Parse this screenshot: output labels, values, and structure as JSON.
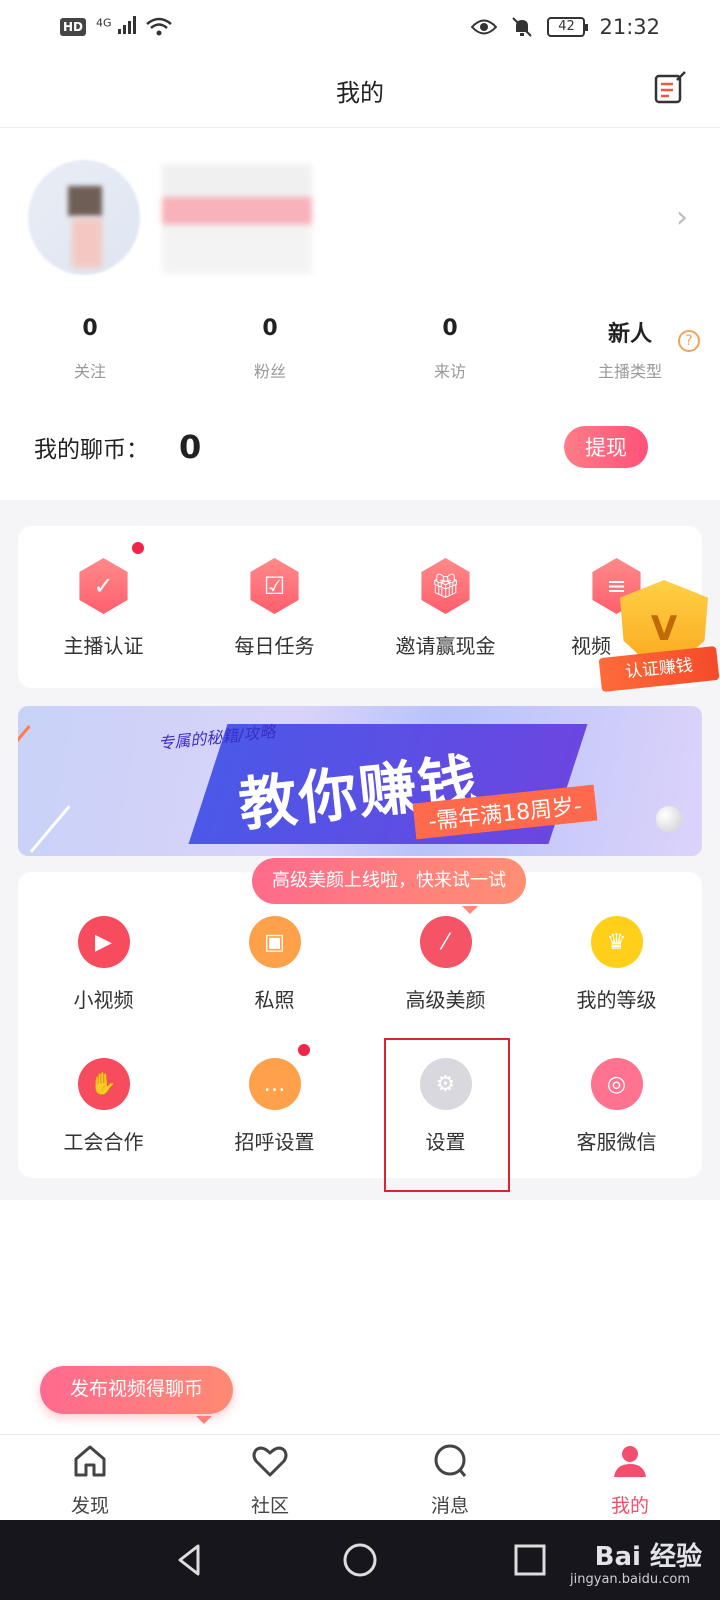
{
  "status_bar": {
    "hd": "HD",
    "network": "4G",
    "battery": "42",
    "time": "21:32"
  },
  "header": {
    "title": "我的"
  },
  "stats": [
    {
      "value": "0",
      "label": "关注"
    },
    {
      "value": "0",
      "label": "粉丝"
    },
    {
      "value": "0",
      "label": "来访"
    },
    {
      "value": "新人",
      "label": "主播类型"
    }
  ],
  "coins": {
    "label": "我的聊币：",
    "value": "0",
    "withdraw": "提现"
  },
  "top_actions": [
    {
      "label": "主播认证",
      "icon": "shield-check-icon"
    },
    {
      "label": "每日任务",
      "icon": "clipboard-check-icon"
    },
    {
      "label": "邀请赢现金",
      "icon": "gift-icon"
    },
    {
      "label": "视频",
      "icon": "sliders-icon"
    }
  ],
  "cert_badge": {
    "text": "认证赚钱"
  },
  "banner": {
    "sub": "专属的秘籍/攻略",
    "title": "教你赚钱",
    "age_note": "-需年满18周岁-"
  },
  "tooltip": {
    "text": "高级美颜上线啦，快来试一试"
  },
  "grid_items": [
    {
      "label": "小视频",
      "icon": "play-icon",
      "color": "#f74b5e"
    },
    {
      "label": "私照",
      "icon": "image-icon",
      "color": "#ffa14a"
    },
    {
      "label": "高级美颜",
      "icon": "magic-wand-icon",
      "color": "#f45466"
    },
    {
      "label": "我的等级",
      "icon": "crown-icon",
      "color": "#ffcf1a"
    },
    {
      "label": "工会合作",
      "icon": "handshake-icon",
      "color": "#f74b5e"
    },
    {
      "label": "招呼设置",
      "icon": "chat-bubble-icon",
      "color": "#ffa14a"
    },
    {
      "label": "设置",
      "icon": "gear-icon",
      "color": "#d8d8de"
    },
    {
      "label": "客服微信",
      "icon": "wechat-icon",
      "color": "#ff7290"
    }
  ],
  "publish": {
    "text": "发布视频得聊币"
  },
  "tabs": [
    {
      "label": "发现",
      "icon": "home-icon",
      "active": false
    },
    {
      "label": "社区",
      "icon": "heart-icon",
      "active": false
    },
    {
      "label": "消息",
      "icon": "message-icon",
      "active": false
    },
    {
      "label": "我的",
      "icon": "person-icon",
      "active": true
    }
  ],
  "accent_color": "#f44e6e",
  "watermark": {
    "text": "Bai 经验",
    "sub": "jingyan.baidu.com"
  }
}
